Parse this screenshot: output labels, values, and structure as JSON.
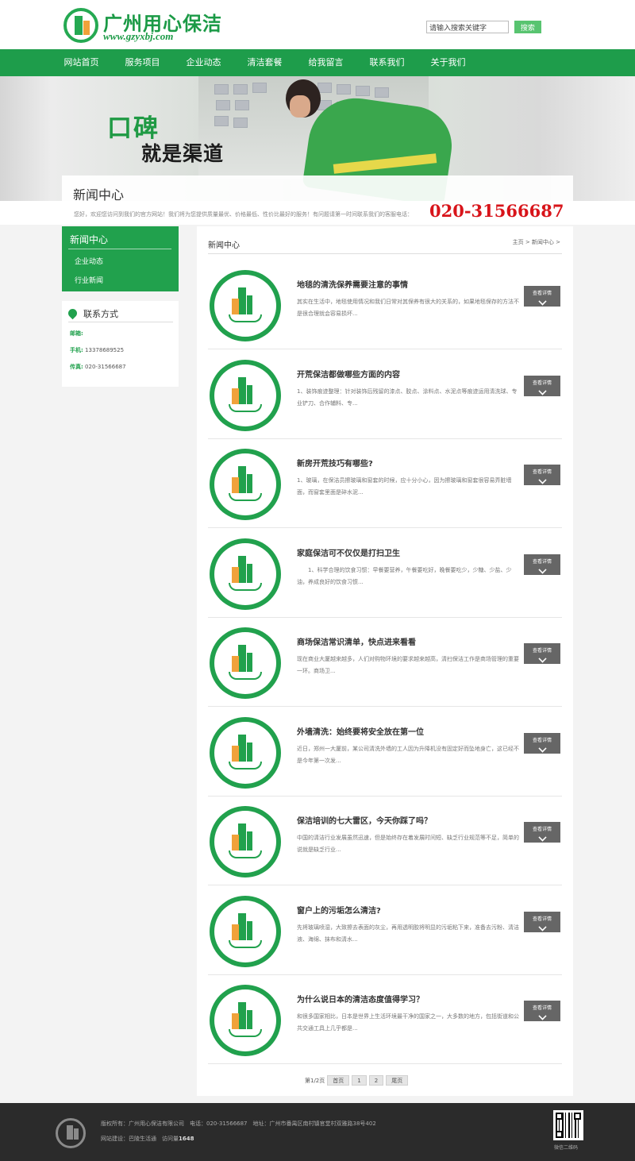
{
  "header": {
    "site_name": "广州用心保洁",
    "site_url": "www.gzyxbj.com",
    "search_placeholder": "请输入搜索关键字",
    "search_button": "搜索"
  },
  "nav": [
    "网站首页",
    "服务项目",
    "企业动态",
    "清洁套餐",
    "给我留言",
    "联系我们",
    "关于我们"
  ],
  "banner": {
    "slogan_line1": "口碑",
    "slogan_line2": "就是渠道",
    "page_title": "新闻中心"
  },
  "welcome": {
    "message": "您好，欢迎您访问到我们的官方网站！我们将为您提供质量最优、价格最低、性价比最好的服务！有问题请第一时间联系我们的客服电话：",
    "phone": "020-31566687"
  },
  "sidebar": {
    "title": "新闻中心",
    "items": [
      "企业动态",
      "行业新闻"
    ],
    "contact": {
      "title": "联系方式",
      "email_label": "邮箱:",
      "email_value": "",
      "mobile_label": "手机:",
      "mobile_value": "13378689525",
      "fax_label": "传真:",
      "fax_value": "020-31566687"
    }
  },
  "main": {
    "title": "新闻中心",
    "breadcrumb": "主页 > 新闻中心 >",
    "more_label": "查看详情",
    "news": [
      {
        "title": "地毯的清洗保养需要注意的事情",
        "desc": "其实在生活中，地毯使用情况和我们日常对其保养有很大的关系的，如果地毯保存的方法不是很合理就会容易损坏..."
      },
      {
        "title": "开荒保洁都做哪些方面的内容",
        "desc": "1、装饰痕迹整理：针对装饰后残留的漆点、胶点、涂料点、水泥点等痕迹运用清洗球、专业铲刀、合作辅料、专..."
      },
      {
        "title": "新房开荒技巧有哪些?",
        "desc": "1、玻璃，在保洁员擦玻璃和窗套的时候，应十分小心，因为擦玻璃和窗套很容易弄脏墙面，而窗套里面是碎水泥..."
      },
      {
        "title": "家庭保洁可不仅仅是打扫卫生",
        "desc": "　　1、科学合理的饮食习惯：早餐要营养，午餐要吃好，晚餐要吃少，少糖、少盐、少油，养成良好的饮食习惯..."
      },
      {
        "title": "商场保洁常识清单，快点进来看看",
        "desc": "现在商业大厦越来越多，人们对购物环境的要求越来越高，清扫保洁工作是商场管理的重要一环。商场卫..."
      },
      {
        "title": "外墙清洗：始终要将安全放在第一位",
        "desc": "近日，郑州一大厦前，某公司清洗外墙的工人因为升降机没有固定好而坠地身亡，这已经不是今年第一次发..."
      },
      {
        "title": "保洁培训的七大雷区，今天你踩了吗？",
        "desc": "中国的清洁行业发展虽然迅速，但是始终存在着发展时间短、缺乏行业规范等不足，简单的说就是缺乏行业..."
      },
      {
        "title": "窗户上的污垢怎么清洁?",
        "desc": "先将玻璃喷湿，大致擦去表面的灰尘，再用透明胶将明显的污垢粘下来，准备去污粉、清洁液、海绵、抹布和清水..."
      },
      {
        "title": "为什么说日本的清洁态度值得学习？",
        "desc": "和很多国家相比，日本是世界上生活环境最干净的国家之一，大多数的地方，包括街道和公共交通工具上几乎都是..."
      }
    ],
    "pager": {
      "info": "第1/2页",
      "first": "首页",
      "p1": "1",
      "p2": "2",
      "last": "尾页"
    }
  },
  "footer": {
    "line1": "版权所有：广州用心保洁有限公司　电话：020-31566687　地址：广州市番禺区南村镇官堂村双雅路38号402",
    "line2_prefix": "网站建设：巴陵生活通　访问量",
    "visits": "1648",
    "qr_label": "微信二维码"
  },
  "colors": {
    "brand_green": "#1e9d4b",
    "phone_red": "#d8141a",
    "footer_bg": "#2b2b2b"
  }
}
